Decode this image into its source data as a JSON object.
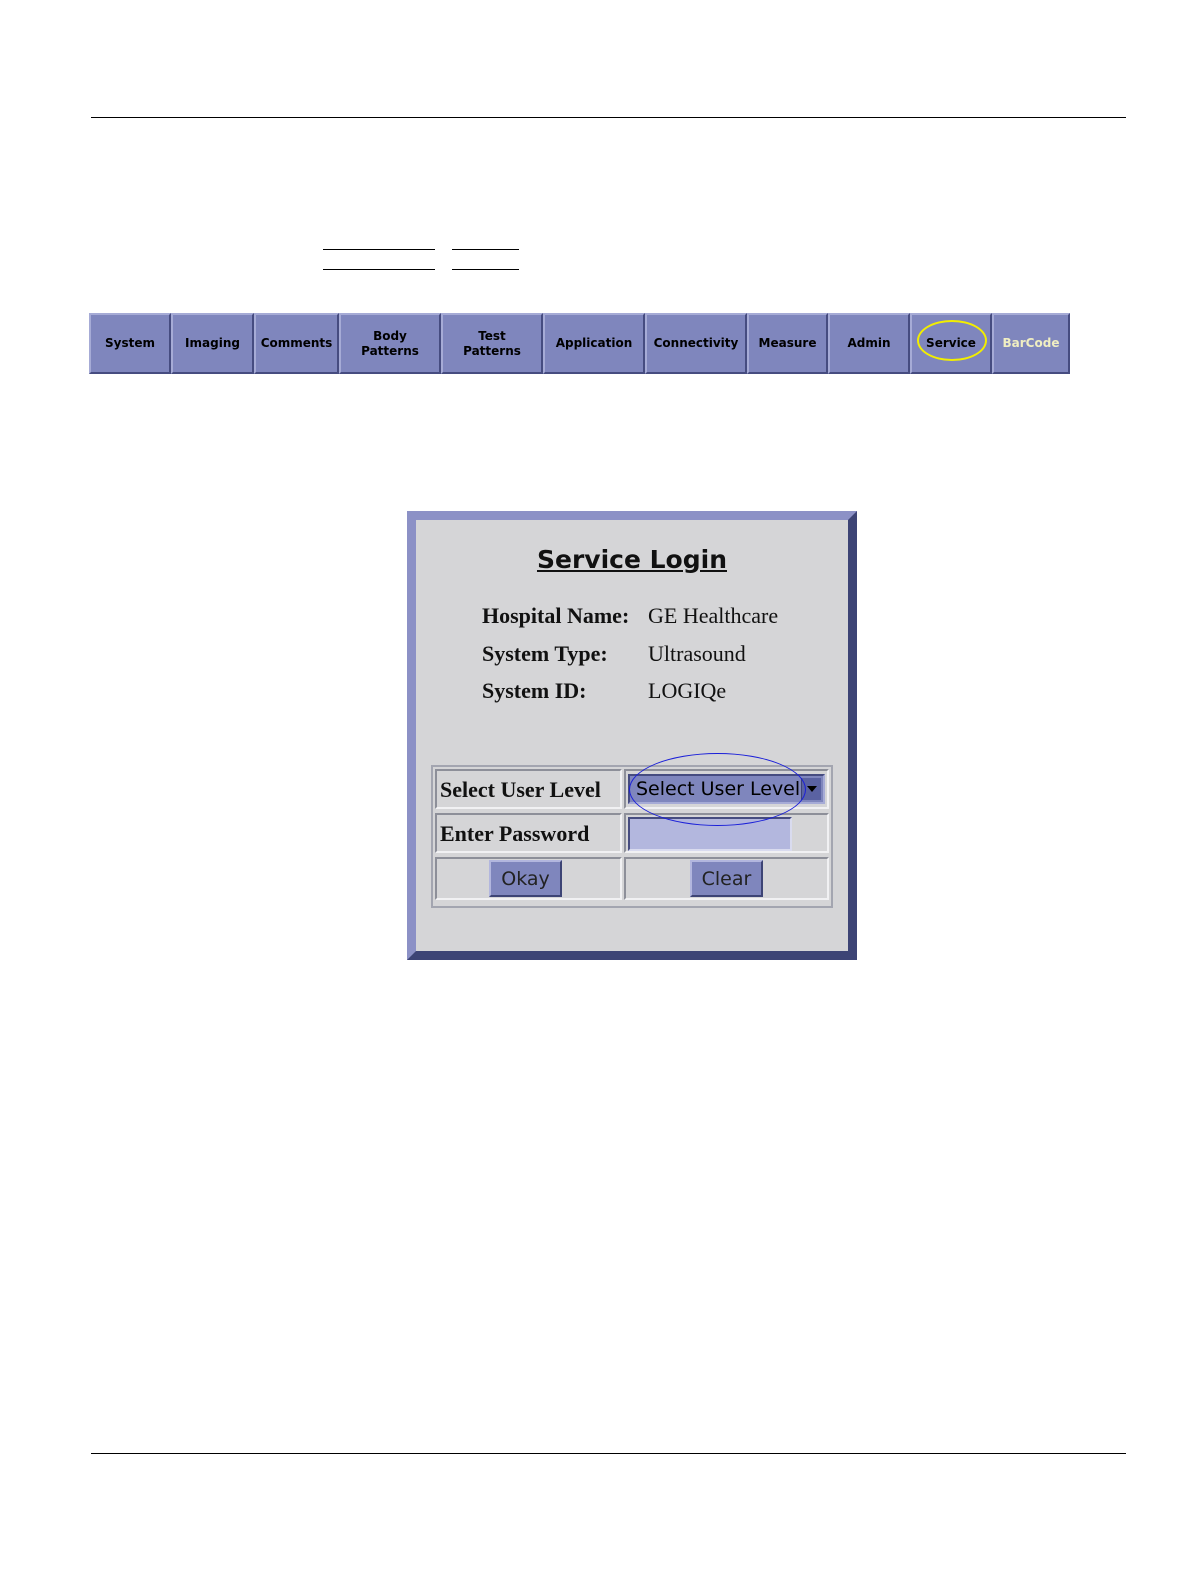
{
  "tabs": [
    {
      "label": "System"
    },
    {
      "label": "Imaging"
    },
    {
      "label": "Comments"
    },
    {
      "label": "Body\nPatterns"
    },
    {
      "label": "Test\nPatterns"
    },
    {
      "label": "Application"
    },
    {
      "label": "Connectivity"
    },
    {
      "label": "Measure"
    },
    {
      "label": "Admin"
    },
    {
      "label": "Service",
      "highlighted": true
    },
    {
      "label": "BarCode"
    }
  ],
  "dialog": {
    "title": "Service Login",
    "info": [
      {
        "key": "Hospital Name:",
        "value": "GE Healthcare"
      },
      {
        "key": "System Type:",
        "value": "Ultrasound"
      },
      {
        "key": "System ID:",
        "value": "LOGIQe"
      }
    ],
    "form": {
      "user_level_label": "Select User Level",
      "user_level_value": "Select User Level",
      "password_label": "Enter Password",
      "password_value": "",
      "okay_label": "Okay",
      "clear_label": "Clear"
    }
  },
  "colors": {
    "tab_face": "#7f86bd",
    "dialog_bg": "#d5d5d7",
    "highlight_yellow": "#f2ee00",
    "highlight_blue": "#1a1fd8",
    "barcode_text": "#f0eec2"
  }
}
